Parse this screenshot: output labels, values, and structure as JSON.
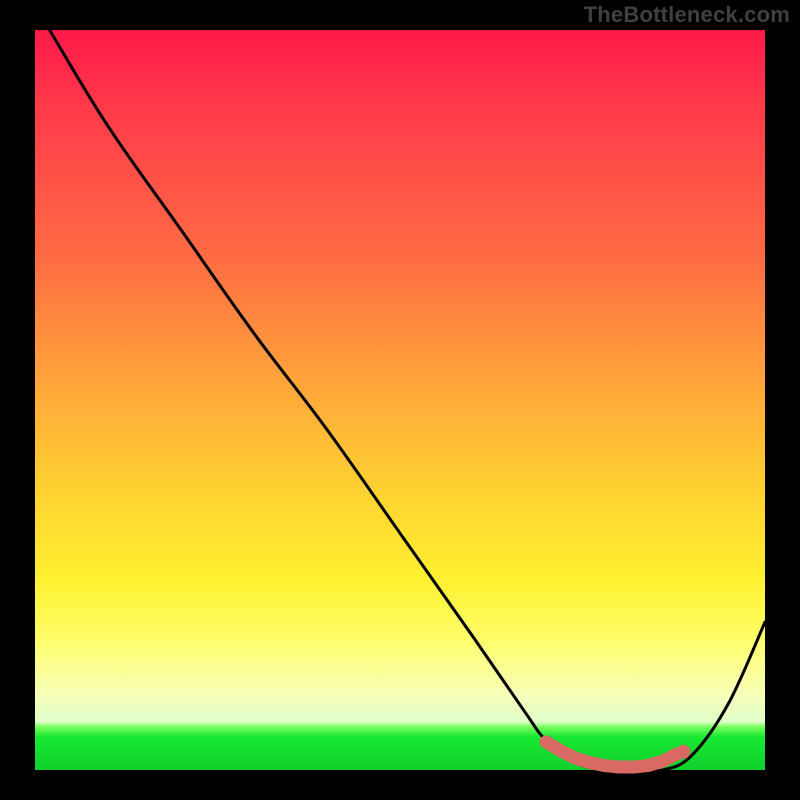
{
  "watermark": "TheBottleneck.com",
  "colors": {
    "page_bg": "#000000",
    "gradient_top": "#ff1a49",
    "gradient_mid": "#ffd131",
    "gradient_low": "#fffd67",
    "gradient_green": "#18e833",
    "curve_stroke": "#000000",
    "marker_fill": "#d86a63"
  },
  "chart_data": {
    "type": "line",
    "title": "",
    "xlabel": "",
    "ylabel": "",
    "xlim": [
      0,
      100
    ],
    "ylim": [
      0,
      100
    ],
    "note": "Bottleneck-percentage style curve. x represents a normalized performance/axis value; y represents bottleneck percentage. Values are read from the rendered curve (no axis ticks present, so estimated to whole-number precision).",
    "series": [
      {
        "name": "bottleneck_curve",
        "x": [
          2,
          10,
          20,
          30,
          40,
          50,
          60,
          67,
          70,
          74,
          78,
          82,
          86,
          90,
          95,
          100
        ],
        "y": [
          100,
          87,
          73,
          59,
          46,
          32,
          18,
          8,
          4,
          1,
          0,
          0,
          0,
          2,
          9,
          20
        ]
      }
    ],
    "markers": {
      "name": "optimal_range",
      "x": [
        70,
        72,
        74,
        76,
        78,
        80,
        82,
        84,
        86,
        88
      ],
      "y": [
        3.8,
        2.6,
        1.6,
        1.0,
        0.6,
        0.4,
        0.4,
        0.6,
        1.2,
        2.2
      ]
    }
  }
}
